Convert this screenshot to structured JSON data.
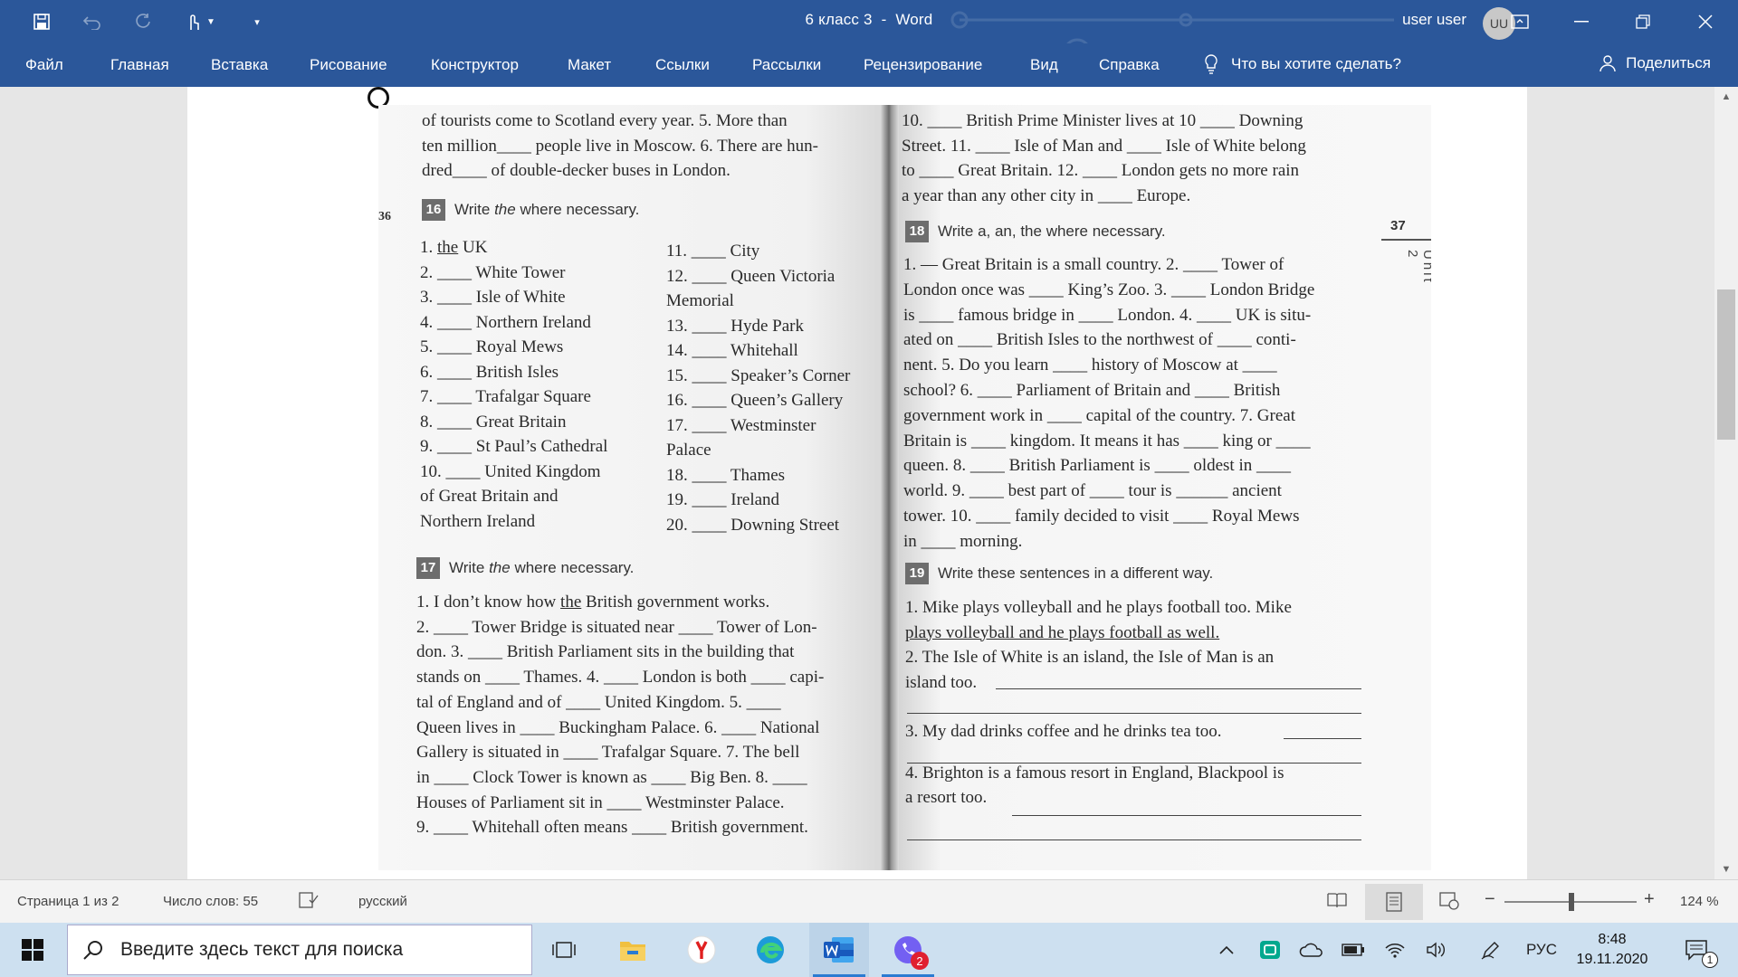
{
  "titlebar": {
    "document_title": "6 класс 3",
    "separator": "-",
    "app_name": "Word",
    "user_name": "user user",
    "avatar_initials": "UU"
  },
  "ribbon": {
    "tabs": [
      "Файл",
      "Главная",
      "Вставка",
      "Рисование",
      "Конструктор",
      "Макет",
      "Ссылки",
      "Рассылки",
      "Рецензирование",
      "Вид",
      "Справка"
    ],
    "tell_me": "Что вы хотите сделать?",
    "share": "Поделиться"
  },
  "book": {
    "left_top_lines": [
      "of tourists come to Scotland every year. 5. More than",
      "ten million____ people live in Moscow. 6. There are hun-",
      "dred____ of double-decker buses in London."
    ],
    "page_left_number": "36",
    "ex16": {
      "number": "16",
      "instruction_pre": "Write ",
      "instruction_em": "the",
      "instruction_post": " where necessary.",
      "col1": [
        "1. the UK",
        "2. ____ White Tower",
        "3. ____ Isle of White",
        "4. ____ Northern Ireland",
        "5. ____ Royal Mews",
        "6. ____ British Isles",
        "7. ____ Trafalgar Square",
        "8. ____ Great Britain",
        "9. ____ St Paul’s Cathedral",
        "10. ____ United Kingdom",
        "of Great Britain and",
        "Northern Ireland"
      ],
      "col2": [
        "11. ____ City",
        "12. ____ Queen Victoria",
        "Memorial",
        "13. ____ Hyde Park",
        "14. ____ Whitehall",
        "15. ____ Speaker’s Corner",
        "16. ____ Queen’s Gallery",
        "17. ____ Westminster",
        "Palace",
        "18. ____ Thames",
        "19. ____ Ireland",
        "20. ____ Downing Street"
      ]
    },
    "ex17": {
      "number": "17",
      "instruction_pre": "Write ",
      "instruction_em": "the",
      "instruction_post": " where necessary.",
      "lines": [
        "1. I don’t know how the British government works.",
        "2. ____ Tower Bridge is situated near ____ Tower of Lon-",
        "don. 3. ____ British Parliament sits in the building that",
        "stands on ____ Thames. 4. ____ London is both ____ capi-",
        "tal of England and of ____ United Kingdom. 5. ____",
        "Queen lives in ____ Buckingham Palace. 6. ____ National",
        "Gallery is situated in ____ Trafalgar Square. 7. The bell",
        "in ____ Clock Tower is known as ____ Big Ben. 8. ____",
        "Houses of Parliament sit in ____ Westminster Palace.",
        "9. ____ Whitehall often means ____ British government."
      ]
    },
    "right_top_lines": [
      "10. ____ British Prime Minister lives at 10 ____ Downing",
      "Street. 11. ____ Isle of Man and ____ Isle of White belong",
      "to ____ Great Britain. 12. ____ London gets no more rain",
      "a year than any other city in ____ Europe."
    ],
    "page_right_number": "37",
    "unit_label": "Unit 2",
    "ex18": {
      "number": "18",
      "instruction": "Write a, an, the where necessary.",
      "lines": [
        "1. — Great Britain is a small country. 2. ____ Tower of",
        "London once was ____ King’s Zoo. 3. ____ London Bridge",
        "is ____ famous bridge in ____ London. 4. ____ UK is situ-",
        "ated on ____ British Isles to the northwest of ____ conti-",
        "nent. 5. Do you learn ____ history of Moscow at ____",
        "school? 6. ____ Parliament of Britain and ____ British",
        "government work in ____ capital of the country. 7. Great",
        "Britain is ____ kingdom. It means it has ____ king or ____",
        "queen. 8. ____ British Parliament is ____ oldest in ____",
        "world. 9. ____ best part of ____ tour is ______ ancient",
        "tower. 10. ____ family decided to visit ____ Royal Mews",
        "in ____ morning."
      ]
    },
    "ex19": {
      "number": "19",
      "instruction": "Write these sentences in a different way.",
      "lines": [
        "1. Mike plays volleyball and he plays football too. Mike",
        "plays volleyball and he plays football as well.",
        "2. The Isle of White is an island, the Isle of Man is an",
        "island too.",
        "3. My dad drinks coffee and he drinks tea too.",
        "4. Brighton is a famous resort in England, Blackpool is",
        "a resort too."
      ]
    }
  },
  "statusbar": {
    "page": "Страница 1 из 2",
    "words": "Число слов: 55",
    "language": "русский",
    "zoom": "124 %"
  },
  "taskbar": {
    "search_placeholder": "Введите здесь текст для поиска",
    "viber_badge": "2",
    "language": "РУС",
    "time": "8:48",
    "date": "19.11.2020",
    "notification_badge": "1"
  }
}
